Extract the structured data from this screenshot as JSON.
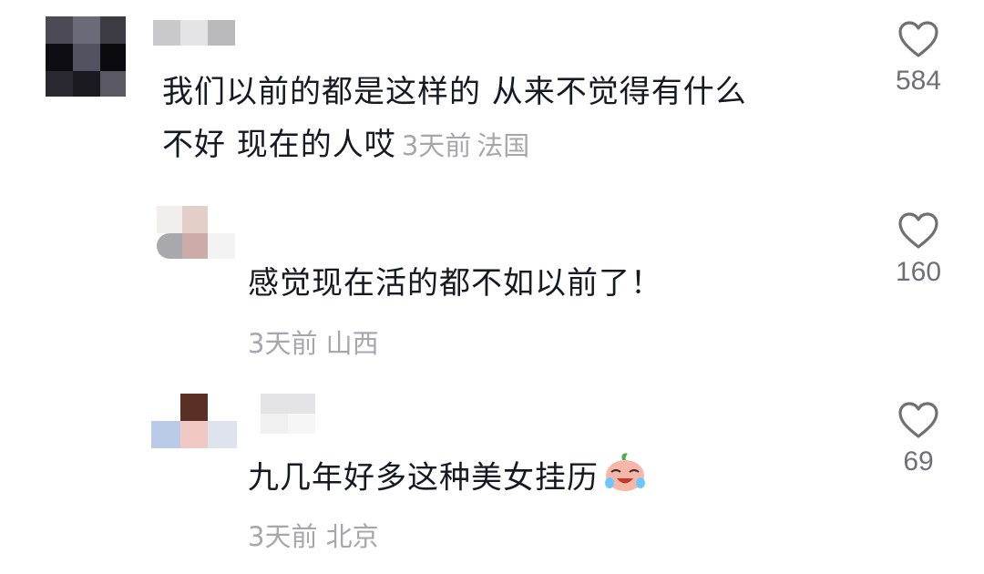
{
  "comments": [
    {
      "text": "我们以前的都是这样的 从来不觉得有什么不好 现在的人哎",
      "line1": "我们以前的都是这样的 从来不觉得有什么",
      "line2": "不好 现在的人哎",
      "time": "3天前",
      "location": "法国",
      "likes": "584",
      "is_reply": false
    },
    {
      "text": "感觉现在活的都不如以前了！",
      "time": "3天前",
      "location": "山西",
      "likes": "160",
      "is_reply": true
    },
    {
      "text": "九几年好多这种美女挂历",
      "time": "3天前",
      "location": "北京",
      "likes": "69",
      "is_reply": true,
      "emoji": "crying-laughing-emoji"
    }
  ],
  "icons": {
    "like": "heart-outline-icon"
  },
  "colors": {
    "meta": "#a7a7ab",
    "count": "#6f6f74",
    "text": "#161823"
  }
}
